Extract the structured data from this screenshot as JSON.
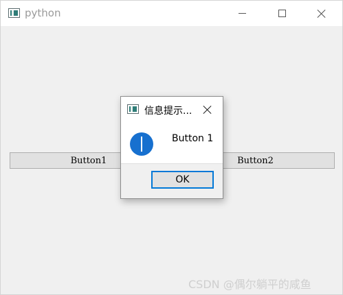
{
  "main_window": {
    "title": "python",
    "icon": "python-app-icon",
    "controls": {
      "minimize_icon": "minimize-icon",
      "maximize_icon": "maximize-icon",
      "close_icon": "close-icon"
    }
  },
  "buttons": [
    {
      "label": "Button1"
    },
    {
      "label": "Button2"
    }
  ],
  "dialog": {
    "title": "信息提示...",
    "icon": "app-icon",
    "close_icon": "close-icon",
    "message_icon": "info-icon",
    "message": "Button 1",
    "ok_label": "OK",
    "accent_color": "#0078d7",
    "info_icon_color": "#1770cf"
  },
  "watermark": "CSDN @偶尔躺平的咸鱼"
}
